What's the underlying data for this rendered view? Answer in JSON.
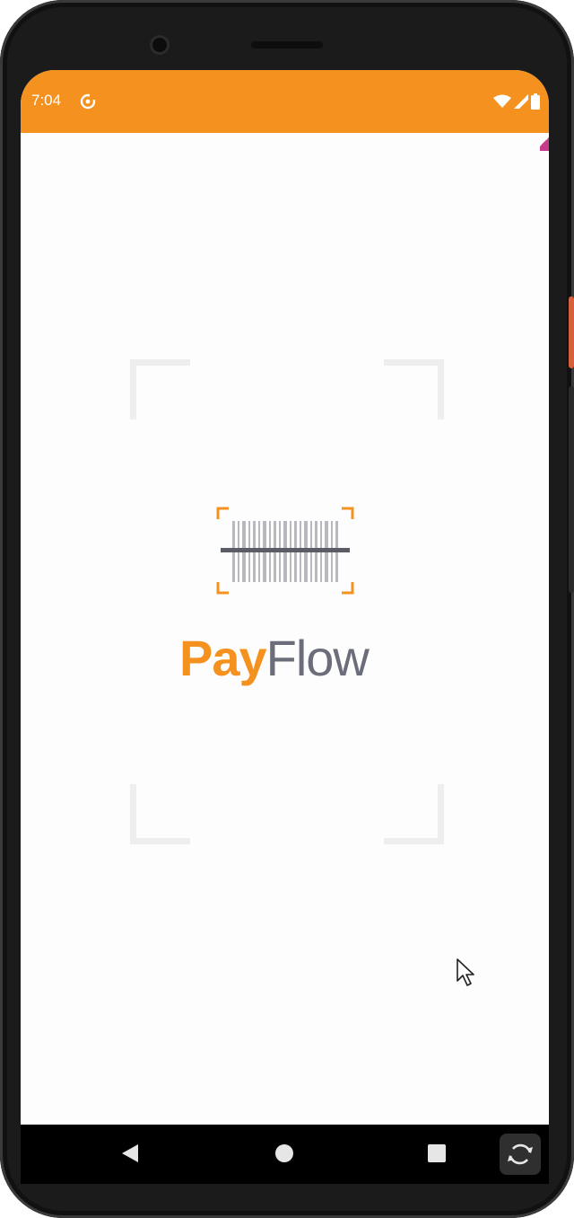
{
  "status_bar": {
    "time": "7:04",
    "sync_icon": "sync-icon",
    "wifi_icon": "wifi-icon",
    "signal_icon": "signal-icon",
    "battery_icon": "battery-icon",
    "color": "#f5921f"
  },
  "splash": {
    "logo_icon": "barcode-scanner-icon",
    "brand_part1": "Pay",
    "brand_part2": "Flow",
    "brand_color_primary": "#f5921f",
    "brand_color_secondary": "#6b6e7a",
    "frame_color": "#eeeeee"
  },
  "nav_bar": {
    "back_icon": "back-triangle-icon",
    "home_icon": "home-circle-icon",
    "recents_icon": "recents-square-icon",
    "rotate_icon": "rotate-icon"
  }
}
